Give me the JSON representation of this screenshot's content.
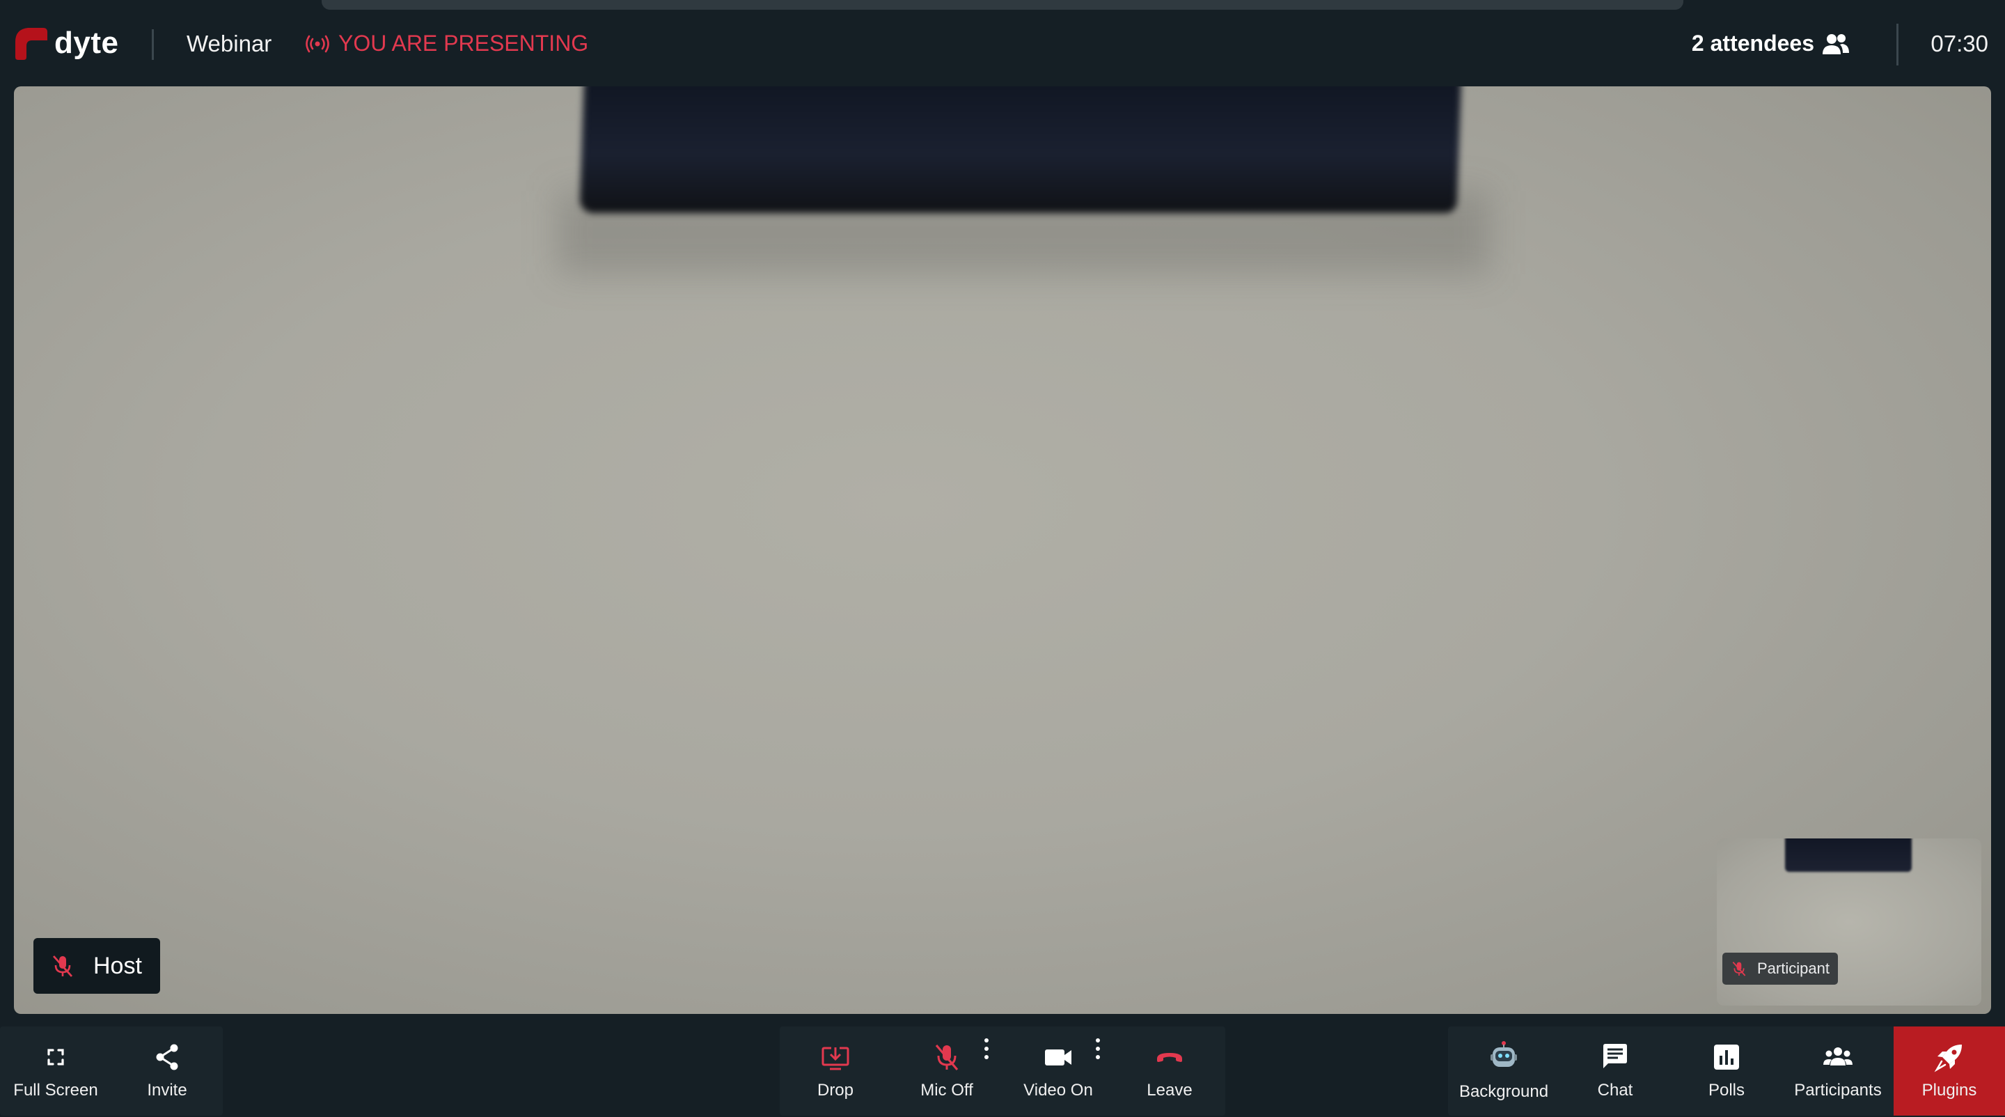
{
  "app": {
    "logo_text": "dyte",
    "meeting_title": "Webinar",
    "presenting_label": "YOU ARE PRESENTING"
  },
  "header": {
    "attendees_label": "2 attendees",
    "clock": "07:30"
  },
  "stage": {
    "host_label": "Host",
    "participant_label": "Participant"
  },
  "controls": {
    "left": [
      {
        "label": "Full Screen",
        "icon": "fullscreen-icon"
      },
      {
        "label": "Invite",
        "icon": "share-icon"
      }
    ],
    "center": [
      {
        "label": "Drop",
        "icon": "drop-screen-icon"
      },
      {
        "label": "Mic Off",
        "icon": "mic-off-icon"
      },
      {
        "label": "Video On",
        "icon": "video-camera-icon"
      },
      {
        "label": "Leave",
        "icon": "phone-hangup-icon"
      }
    ],
    "right": [
      {
        "label": "Background",
        "icon": "robot-icon"
      },
      {
        "label": "Chat",
        "icon": "chat-icon"
      },
      {
        "label": "Polls",
        "icon": "poll-icon"
      },
      {
        "label": "Participants",
        "icon": "participants-icon"
      },
      {
        "label": "Plugins",
        "icon": "rocket-icon"
      }
    ]
  },
  "colors": {
    "accent": "#e2394f",
    "plugins_bg": "#b91c22",
    "background": "#151f25"
  }
}
